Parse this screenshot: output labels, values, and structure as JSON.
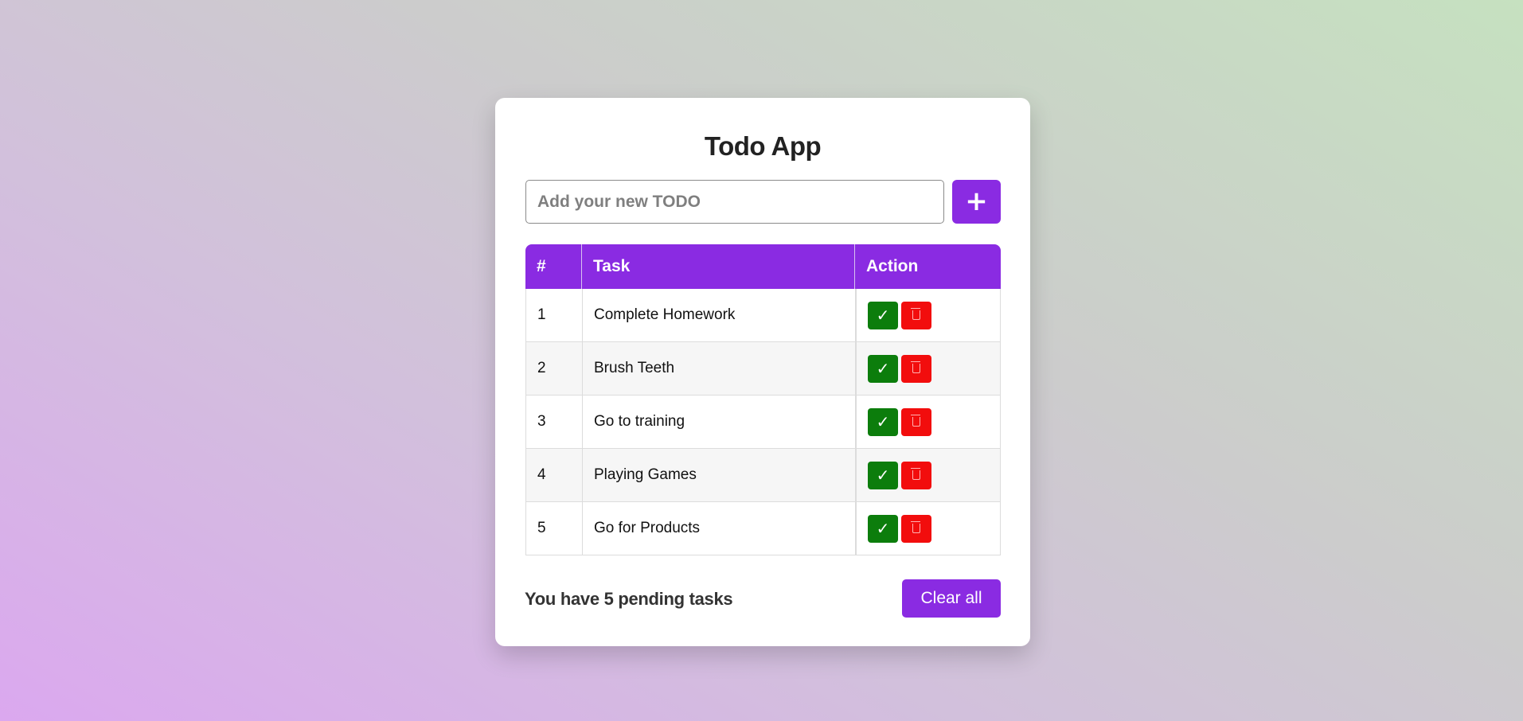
{
  "app": {
    "title": "Todo App"
  },
  "form": {
    "placeholder": "Add your new TODO",
    "value": "",
    "add_label": "+"
  },
  "table": {
    "headers": [
      "#",
      "Task",
      "Action"
    ],
    "rows": [
      {
        "num": "1",
        "task": "Complete Homework"
      },
      {
        "num": "2",
        "task": "Brush Teeth"
      },
      {
        "num": "3",
        "task": "Go to training"
      },
      {
        "num": "4",
        "task": "Playing Games"
      },
      {
        "num": "5",
        "task": "Go for Products"
      }
    ],
    "done_label": "✓",
    "delete_icon": "trash-icon"
  },
  "footer": {
    "pending_text": "You have 5 pending tasks",
    "clear_label": "Clear all"
  },
  "colors": {
    "accent": "#8a2be2",
    "done": "#0c7d0c",
    "delete": "#f20d0d"
  }
}
